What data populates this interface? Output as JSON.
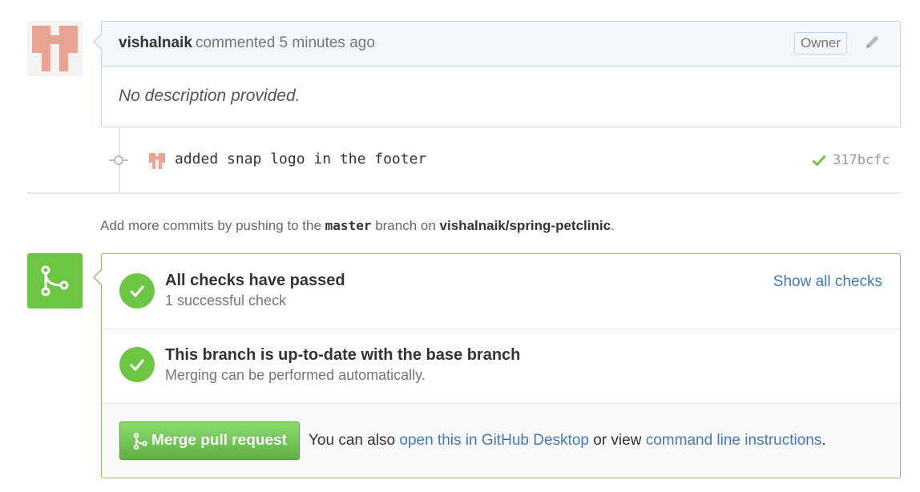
{
  "comment": {
    "author": "vishalnaik",
    "action": "commented 5 minutes ago",
    "badge": "Owner",
    "body": "No description provided."
  },
  "commit": {
    "message": "added snap logo in the footer",
    "sha": "317bcfc"
  },
  "push_note": {
    "prefix": "Add more commits by pushing to the",
    "branch": "master",
    "middle": "branch on",
    "repo": "vishalnaik/spring-petclinic",
    "suffix": "."
  },
  "checks": {
    "title": "All checks have passed",
    "subtitle": "1 successful check",
    "show_all_label": "Show all checks"
  },
  "branch_status": {
    "title": "This branch is up-to-date with the base branch",
    "subtitle": "Merging can be performed automatically."
  },
  "merge": {
    "button_label": "Merge pull request",
    "text_prefix": "You can also",
    "desktop_link": "open this in GitHub Desktop",
    "text_middle": "or view",
    "cli_link": "command line instructions",
    "text_suffix": "."
  },
  "icons": {
    "avatar": "identicon-avatar",
    "edit": "pencil-icon",
    "commit": "git-commit-icon",
    "status": "check-icon",
    "merge": "git-merge-icon"
  },
  "colors": {
    "success_green": "#6cc644",
    "link_blue": "#4078c0",
    "header_blue": "#f2f8fa",
    "avatar_salmon": "#e8a392"
  }
}
